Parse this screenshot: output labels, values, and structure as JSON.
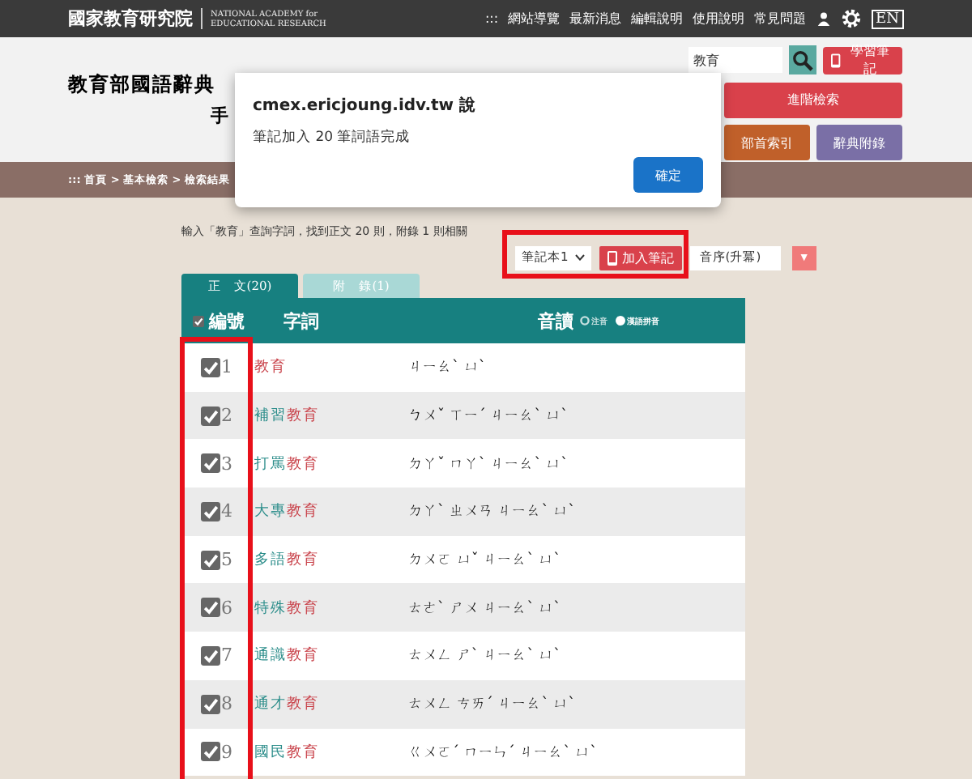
{
  "top_bar": {
    "logo": "國家教育研究院",
    "logo_en_1": "NATIONAL ACADEMY for",
    "logo_en_2": "EDUCATIONAL RESEARCH",
    "nav": [
      ":::",
      "網站導覽",
      "最新消息",
      "編輯說明",
      "使用說明",
      "常見問題"
    ],
    "language": "EN"
  },
  "banner": {
    "title": "教育部國語辭典",
    "subtitle": "手",
    "search": {
      "value": "教育"
    },
    "notes_button": "學習筆記",
    "buttons": [
      {
        "label": "進階檢索",
        "color": "#d9414b"
      },
      {
        "label": "部首索引",
        "color": "#c0602a"
      },
      {
        "label": "辭典附錄",
        "color": "#7a6fa6"
      }
    ]
  },
  "breadcrumb": "::: 首頁 > 基本檢索 > 檢索結果",
  "dialog": {
    "title": "cmex.ericjoung.idv.tw 說",
    "message": "筆記加入 20 筆詞語完成",
    "button": "確定"
  },
  "summary": "輸入「教育」查詢字詞，找到正文 20 則，附錄 1 則相關",
  "toolbar": {
    "notebook": "筆記本1",
    "add_button": "加入筆記",
    "sort": "音序(升冪)",
    "sort_button": "▼"
  },
  "tabs": [
    {
      "label": "正　文(20)",
      "selected": true
    },
    {
      "label": "附　錄(1)",
      "selected": false
    }
  ],
  "table": {
    "columns": [
      "編號",
      "字詞",
      "音讀"
    ],
    "all_checked": true,
    "phonetic_options": [
      {
        "label": "注音",
        "selected": false
      },
      {
        "label": "漢語拼音",
        "selected": true
      }
    ],
    "rows": [
      {
        "number": "1",
        "checked": true,
        "word_parts": [
          {
            "text": "教育",
            "highlight": true
          }
        ],
        "reading": "ㄐㄧㄠˋ ㄩˋ"
      },
      {
        "number": "2",
        "checked": true,
        "word_parts": [
          {
            "text": "補習",
            "highlight": false
          },
          {
            "text": "教育",
            "highlight": true
          }
        ],
        "reading": "ㄅㄨˇ ㄒㄧˊ ㄐㄧㄠˋ ㄩˋ"
      },
      {
        "number": "3",
        "checked": true,
        "word_parts": [
          {
            "text": "打罵",
            "highlight": false
          },
          {
            "text": "教育",
            "highlight": true
          }
        ],
        "reading": "ㄉㄚˇ ㄇㄚˋ ㄐㄧㄠˋ ㄩˋ"
      },
      {
        "number": "4",
        "checked": true,
        "word_parts": [
          {
            "text": "大專",
            "highlight": false
          },
          {
            "text": "教育",
            "highlight": true
          }
        ],
        "reading": "ㄉㄚˋ ㄓㄨㄢ ㄐㄧㄠˋ ㄩˋ"
      },
      {
        "number": "5",
        "checked": true,
        "word_parts": [
          {
            "text": "多語",
            "highlight": false
          },
          {
            "text": "教育",
            "highlight": true
          }
        ],
        "reading": "ㄉㄨㄛ ㄩˇ ㄐㄧㄠˋ ㄩˋ"
      },
      {
        "number": "6",
        "checked": true,
        "word_parts": [
          {
            "text": "特殊",
            "highlight": false
          },
          {
            "text": "教育",
            "highlight": true
          }
        ],
        "reading": "ㄊㄜˋ ㄕㄨ ㄐㄧㄠˋ ㄩˋ"
      },
      {
        "number": "7",
        "checked": true,
        "word_parts": [
          {
            "text": "通識",
            "highlight": false
          },
          {
            "text": "教育",
            "highlight": true
          }
        ],
        "reading": "ㄊㄨㄥ ㄕˋ ㄐㄧㄠˋ ㄩˋ"
      },
      {
        "number": "8",
        "checked": true,
        "word_parts": [
          {
            "text": "通才",
            "highlight": false
          },
          {
            "text": "教育",
            "highlight": true
          }
        ],
        "reading": "ㄊㄨㄥ ㄘㄞˊ ㄐㄧㄠˋ ㄩˋ"
      },
      {
        "number": "9",
        "checked": true,
        "word_parts": [
          {
            "text": "國民",
            "highlight": false
          },
          {
            "text": "教育",
            "highlight": true
          }
        ],
        "reading": "ㄍㄨㄛˊ ㄇㄧㄣˊ ㄐㄧㄠˋ ㄩˋ"
      }
    ]
  }
}
